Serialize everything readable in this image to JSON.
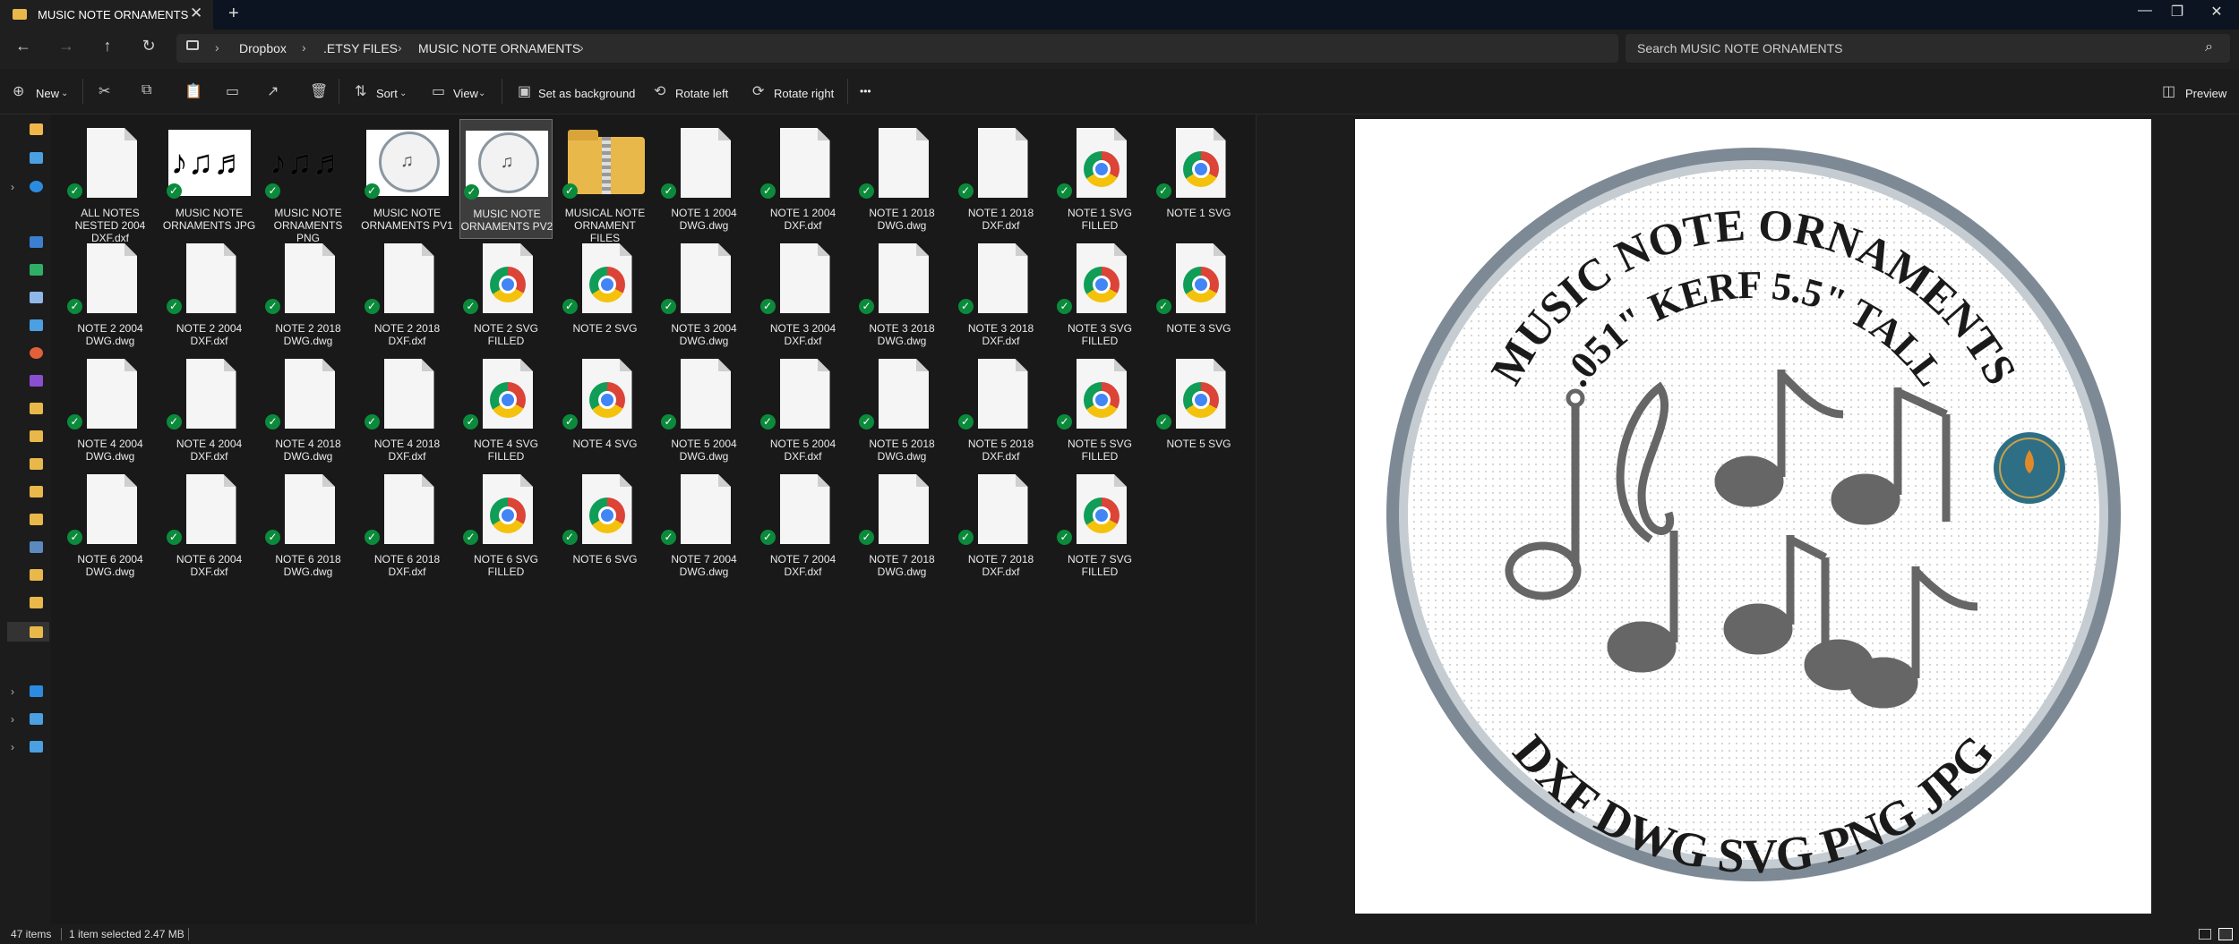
{
  "window": {
    "tab_title": "MUSIC NOTE ORNAMENTS",
    "close": "✕",
    "new_tab": "+",
    "minimize": "—",
    "maximize": "❐",
    "window_close": "✕"
  },
  "nav": {
    "back": "←",
    "forward": "→",
    "up": "↑",
    "refresh": "↻",
    "breadcrumbs": [
      "Dropbox",
      ".ETSY FILES",
      "MUSIC NOTE ORNAMENTS"
    ],
    "search_placeholder": "Search MUSIC NOTE ORNAMENTS",
    "search_icon": "⌕"
  },
  "commands": {
    "new": "New",
    "sort": "Sort",
    "view": "View",
    "set_background": "Set as background",
    "rotate_left": "Rotate left",
    "rotate_right": "Rotate right",
    "more": "•••",
    "preview": "Preview"
  },
  "files": [
    {
      "name": "ALL NOTES NESTED 2004 DXF.dxf",
      "kind": "doc"
    },
    {
      "name": "MUSIC NOTE ORNAMENTS JPG",
      "kind": "img-white"
    },
    {
      "name": "MUSIC NOTE ORNAMENTS PNG",
      "kind": "img-dark"
    },
    {
      "name": "MUSIC NOTE ORNAMENTS PV1",
      "kind": "img-circle"
    },
    {
      "name": "MUSIC NOTE ORNAMENTS PV2",
      "kind": "img-circle",
      "selected": true
    },
    {
      "name": "MUSICAL NOTE ORNAMENT FILES",
      "kind": "folder"
    },
    {
      "name": "NOTE 1 2004 DWG.dwg",
      "kind": "doc"
    },
    {
      "name": "NOTE 1 2004 DXF.dxf",
      "kind": "doc"
    },
    {
      "name": "NOTE 1 2018 DWG.dwg",
      "kind": "doc"
    },
    {
      "name": "NOTE 1 2018 DXF.dxf",
      "kind": "doc"
    },
    {
      "name": "NOTE 1 SVG FILLED",
      "kind": "chrome"
    },
    {
      "name": "NOTE 1 SVG",
      "kind": "chrome"
    },
    {
      "name": "NOTE 2 2004 DWG.dwg",
      "kind": "doc"
    },
    {
      "name": "NOTE 2 2004 DXF.dxf",
      "kind": "doc"
    },
    {
      "name": "NOTE 2 2018 DWG.dwg",
      "kind": "doc"
    },
    {
      "name": "NOTE 2 2018 DXF.dxf",
      "kind": "doc"
    },
    {
      "name": "NOTE 2 SVG FILLED",
      "kind": "chrome"
    },
    {
      "name": "NOTE 2 SVG",
      "kind": "chrome"
    },
    {
      "name": "NOTE 3 2004 DWG.dwg",
      "kind": "doc"
    },
    {
      "name": "NOTE 3 2004 DXF.dxf",
      "kind": "doc"
    },
    {
      "name": "NOTE 3 2018 DWG.dwg",
      "kind": "doc"
    },
    {
      "name": "NOTE 3 2018 DXF.dxf",
      "kind": "doc"
    },
    {
      "name": "NOTE 3 SVG FILLED",
      "kind": "chrome"
    },
    {
      "name": "NOTE 3 SVG",
      "kind": "chrome"
    },
    {
      "name": "NOTE 4 2004 DWG.dwg",
      "kind": "doc"
    },
    {
      "name": "NOTE 4 2004 DXF.dxf",
      "kind": "doc"
    },
    {
      "name": "NOTE 4 2018 DWG.dwg",
      "kind": "doc"
    },
    {
      "name": "NOTE 4 2018 DXF.dxf",
      "kind": "doc"
    },
    {
      "name": "NOTE 4 SVG FILLED",
      "kind": "chrome"
    },
    {
      "name": "NOTE 4 SVG",
      "kind": "chrome"
    },
    {
      "name": "NOTE 5 2004 DWG.dwg",
      "kind": "doc"
    },
    {
      "name": "NOTE 5 2004 DXF.dxf",
      "kind": "doc"
    },
    {
      "name": "NOTE 5 2018 DWG.dwg",
      "kind": "doc"
    },
    {
      "name": "NOTE 5 2018 DXF.dxf",
      "kind": "doc"
    },
    {
      "name": "NOTE 5 SVG FILLED",
      "kind": "chrome"
    },
    {
      "name": "NOTE 5 SVG",
      "kind": "chrome"
    },
    {
      "name": "NOTE 6 2004 DWG.dwg",
      "kind": "doc"
    },
    {
      "name": "NOTE 6 2004 DXF.dxf",
      "kind": "doc"
    },
    {
      "name": "NOTE 6 2018 DWG.dwg",
      "kind": "doc"
    },
    {
      "name": "NOTE 6 2018 DXF.dxf",
      "kind": "doc"
    },
    {
      "name": "NOTE 6 SVG FILLED",
      "kind": "chrome"
    },
    {
      "name": "NOTE 6 SVG",
      "kind": "chrome"
    },
    {
      "name": "NOTE 7 2004 DWG.dwg",
      "kind": "doc"
    },
    {
      "name": "NOTE 7 2004 DXF.dxf",
      "kind": "doc"
    },
    {
      "name": "NOTE 7 2018 DWG.dwg",
      "kind": "doc"
    },
    {
      "name": "NOTE 7 2018 DXF.dxf",
      "kind": "doc"
    },
    {
      "name": "NOTE 7 SVG FILLED",
      "kind": "chrome"
    }
  ],
  "preview": {
    "top_line1": "MUSIC NOTE ORNAMENTS",
    "top_line2": ".051\" KERF 5.5\" TALL",
    "bottom_line": "DXF DWG SVG PNG JPG"
  },
  "status": {
    "count": "47 items",
    "selection": "1 item selected  2.47 MB"
  },
  "colors": {
    "check": "#0b8a3c",
    "folder": "#e9b84a",
    "accent": "#4cc2ff"
  }
}
